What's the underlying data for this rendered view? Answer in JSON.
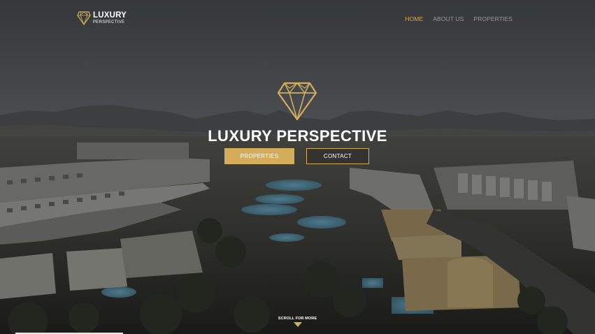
{
  "brand": {
    "title": "LUXURY",
    "subtitle": "PERSPECTIVE"
  },
  "nav": {
    "items": [
      "HOME",
      "ABOUT US",
      "PROPERTIES"
    ],
    "active": "HOME"
  },
  "hero": {
    "title": "LUXURY PERSPECTIVE",
    "primary_button": "PROPERTIES",
    "secondary_button": "CONTACT",
    "scroll_text": "SCROLL FOR MORE"
  },
  "colors": {
    "accent": "#d3ad5b",
    "text": "#ffffff",
    "nav_inactive": "#9a9a98"
  },
  "icons": {
    "logo": "diamond-icon",
    "hero": "diamond-icon",
    "scroll": "chevron-down-icon"
  }
}
